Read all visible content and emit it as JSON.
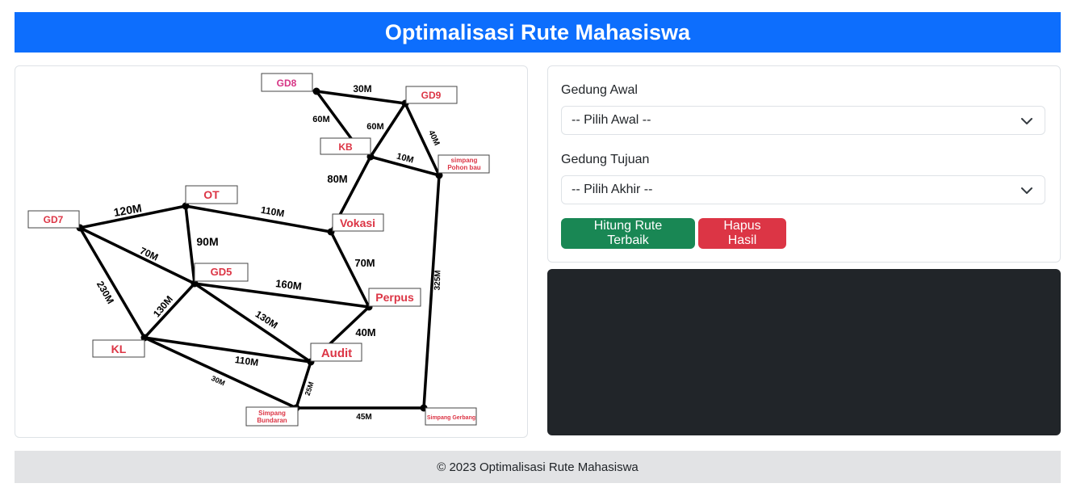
{
  "header": {
    "title": "Optimalisasi Rute Mahasiswa"
  },
  "map": {
    "nodes": {
      "gd8": "GD8",
      "gd9": "GD9",
      "kb": "KB",
      "pohon": "simpang Pohon bau",
      "pohon_line1": "simpang",
      "pohon_line2": "Pohon bau",
      "ot": "OT",
      "gd7": "GD7",
      "vokasi": "Vokasi",
      "gd5": "GD5",
      "perpus": "Perpus",
      "kl": "KL",
      "audit": "Audit",
      "bundaran_line1": "Simpang",
      "bundaran_line2": "Bundaran",
      "gerbang": "Simpang Gerbang"
    },
    "edges": {
      "gd8_gd9": "30M",
      "gd8_kb": "60M",
      "gd9_kb": "60M",
      "gd9_pohon": "40M",
      "kb_pohon": "10M",
      "kb_vokasi": "80M",
      "gd7_ot": "120M",
      "ot_vokasi": "110M",
      "ot_gd5": "90M",
      "gd7_gd5": "70M",
      "gd7_kl": "230M",
      "vokasi_perpus": "70M",
      "gd5_perpus": "160M",
      "gd5_kl": "130M",
      "gd5_audit": "130M",
      "perpus_audit": "40M",
      "kl_audit": "110M",
      "kl_bundaran": "30M",
      "audit_bundaran": "25M",
      "bundaran_gerbang": "45M",
      "pohon_gerbang": "325M"
    }
  },
  "form": {
    "start_label": "Gedung Awal",
    "start_value": "-- Pilih Awal --",
    "end_label": "Gedung Tujuan",
    "end_value": "-- Pilih Akhir --",
    "calc_button": "Hitung Rute Terbaik",
    "clear_button": "Hapus Hasil"
  },
  "footer": {
    "text": "© 2023 Optimalisasi Rute Mahasiswa"
  },
  "colors": {
    "primary": "#0d6efd",
    "success": "#198754",
    "danger": "#dc3545",
    "dark": "#212529",
    "footer_bg": "#e2e3e5"
  }
}
